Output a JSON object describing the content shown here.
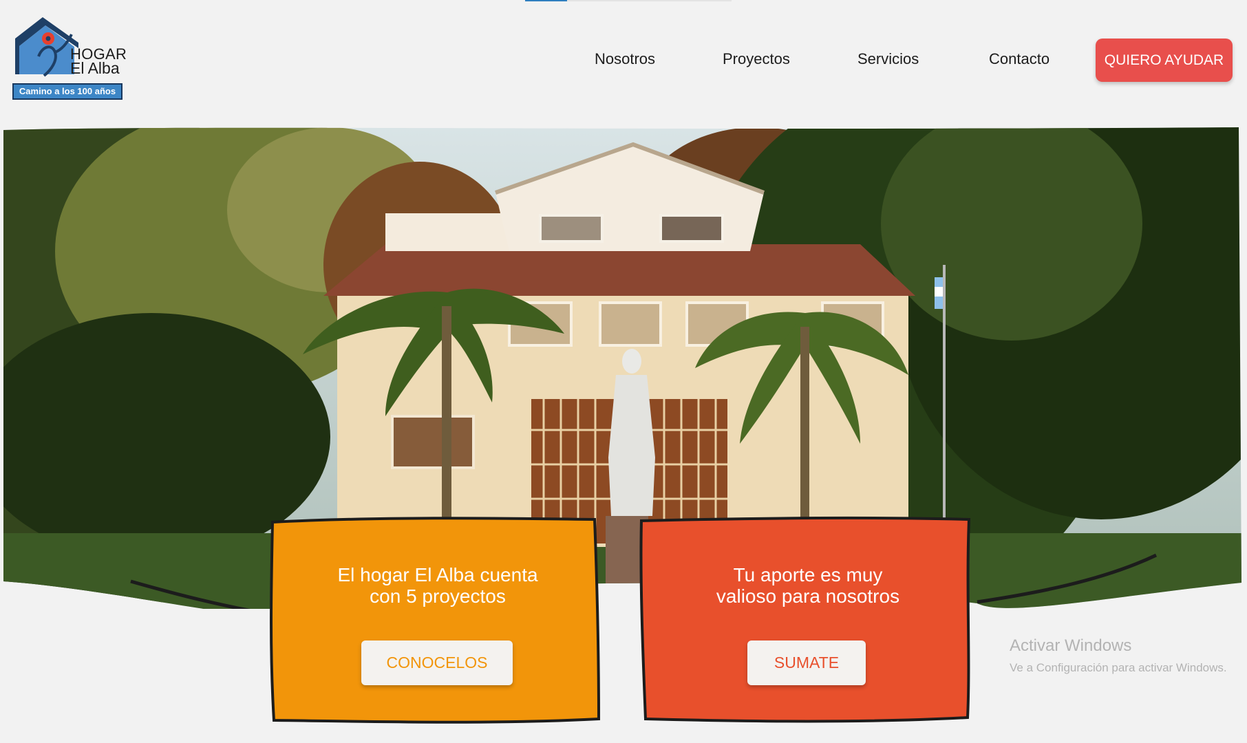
{
  "logo": {
    "line1": "HOGAR",
    "line2": "El Alba",
    "tagline": "Camino a los 100 años"
  },
  "nav": {
    "items": [
      {
        "label": "Nosotros"
      },
      {
        "label": "Proyectos"
      },
      {
        "label": "Servicios"
      },
      {
        "label": "Contacto"
      }
    ],
    "cta_label": "QUIERO AYUDAR"
  },
  "hero": {
    "image_alt": "Hogar El Alba building with statue, palm trees and Argentine flag"
  },
  "cards": [
    {
      "text_line1": "El hogar El Alba cuenta",
      "text_line2": "con 5 proyectos",
      "button_label": "CONOCELOS",
      "color": "#f2950a"
    },
    {
      "text_line1": "Tu aporte es muy",
      "text_line2": "valioso para nosotros",
      "button_label": "SUMATE",
      "color": "#e8502c"
    }
  ],
  "windows_watermark": {
    "title": "Activar Windows",
    "subtitle": "Ve a Configuración para activar Windows."
  },
  "colors": {
    "accent_red": "#e84f4c",
    "card_orange": "#f2950a",
    "card_red": "#e8502c",
    "logo_blue": "#3d86c6"
  }
}
